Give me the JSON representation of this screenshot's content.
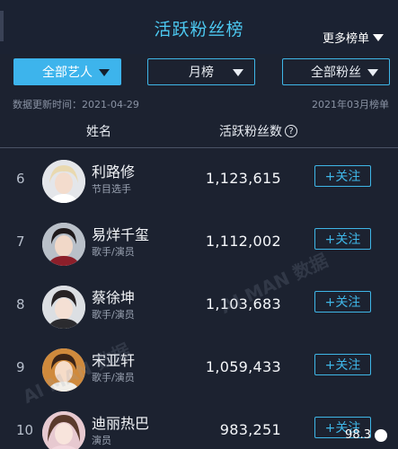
{
  "header": {
    "title": "活跃粉丝榜",
    "more_rank_label": "更多榜单"
  },
  "filters": [
    {
      "label": "全部艺人",
      "active": true
    },
    {
      "label": "月榜",
      "active": false
    },
    {
      "label": "全部粉丝",
      "active": false
    }
  ],
  "meta": {
    "updated": "数据更新时间：2021-04-29",
    "period": "2021年03月榜单"
  },
  "columns": {
    "name": "姓名",
    "fans": "活跃粉丝数",
    "fans_help_icon": "?"
  },
  "rows": [
    {
      "rank": "6",
      "name": "利路修",
      "role": "节目选手",
      "count": "1,123,615",
      "action": "+关注"
    },
    {
      "rank": "7",
      "name": "易烊千玺",
      "role": "歌手/演员",
      "count": "1,112,002",
      "action": "+关注"
    },
    {
      "rank": "8",
      "name": "蔡徐坤",
      "role": "歌手/演员",
      "count": "1,103,683",
      "action": "+关注"
    },
    {
      "rank": "9",
      "name": "宋亚轩",
      "role": "歌手/演员",
      "count": "1,059,433",
      "action": "+关注"
    },
    {
      "rank": "10",
      "name": "迪丽热巴",
      "role": "演员",
      "count": "983,251",
      "action": "+关注"
    }
  ],
  "watermark": "AI MAN 数据",
  "corner_badge": "98.3"
}
